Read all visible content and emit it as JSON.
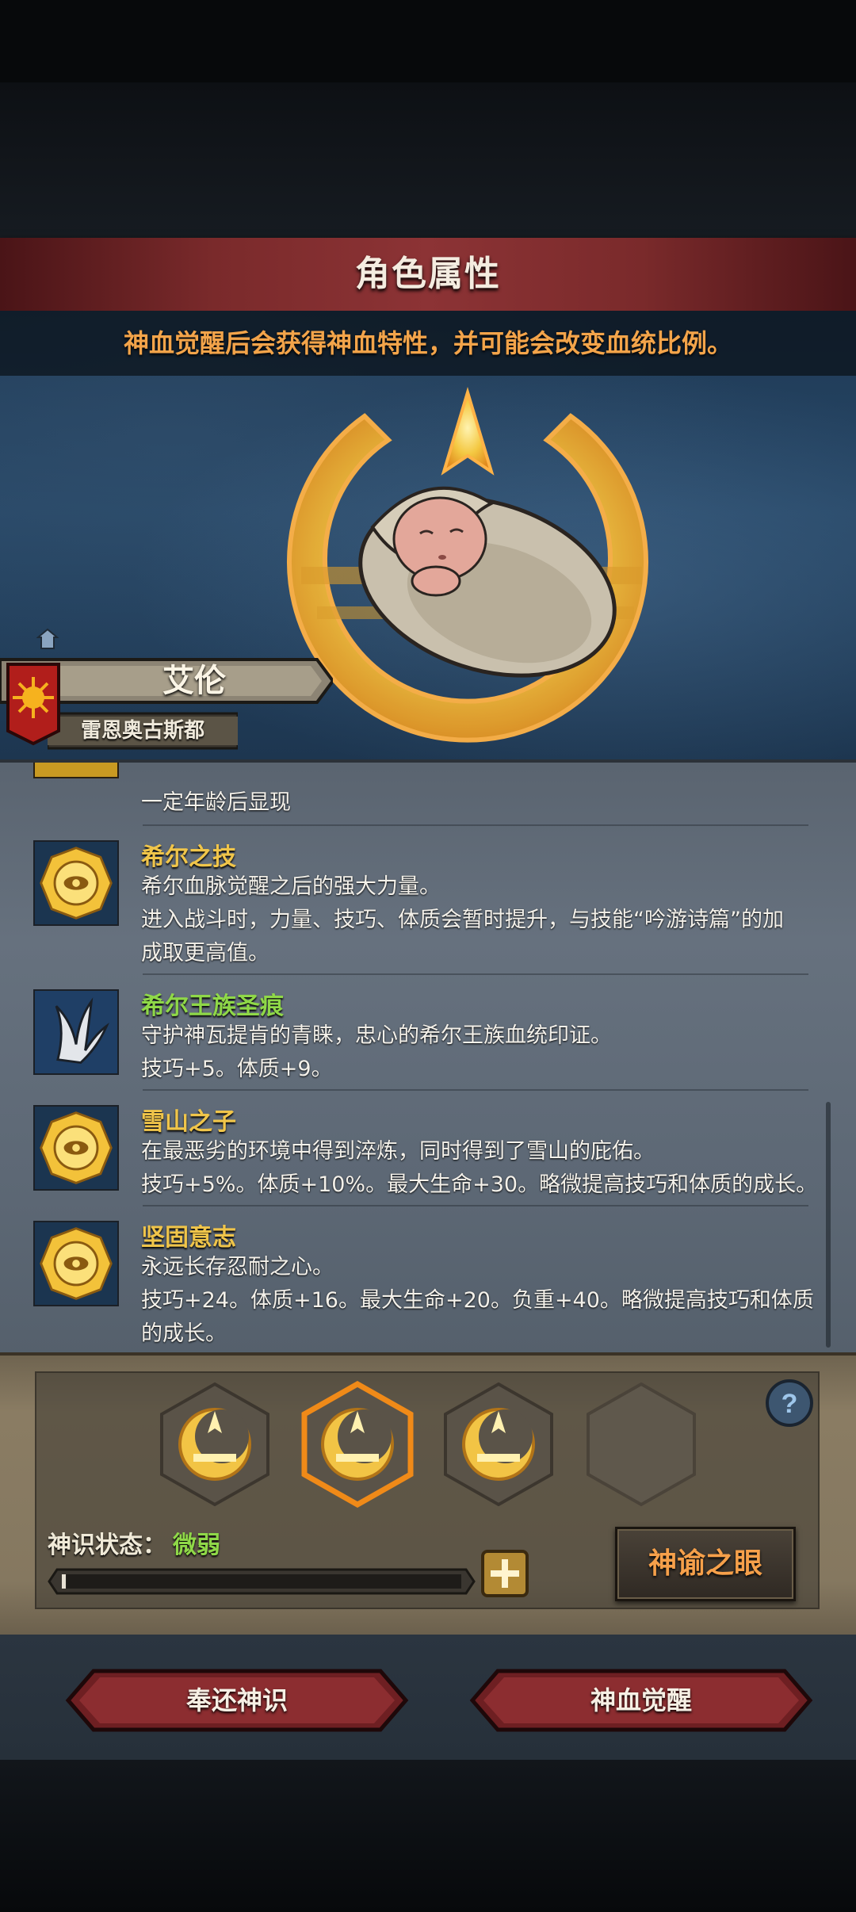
{
  "header": {
    "title": "角色属性"
  },
  "notice": "神血觉醒后会获得神血特性，并可能会改变血统比例。",
  "character": {
    "name": "艾伦",
    "origin": "雷恩奥古斯都"
  },
  "traits": [
    {
      "title": "",
      "desc": [
        "一定年龄后显现"
      ],
      "icon": "lock-icon"
    },
    {
      "title": "希尔之技",
      "desc": [
        "希尔血脉觉醒之后的强大力量。",
        "进入战斗时，力量、技巧、体质会暂时提升，与技能“吟游诗篇”的加",
        "成取更高值。"
      ],
      "icon": "sun-eye-medallion-icon"
    },
    {
      "title": "希尔王族圣痕",
      "desc": [
        "守护神瓦提肯的青睐，忠心的希尔王族血统印证。",
        "技巧+5。体质+9。"
      ],
      "icon": "claw-icon",
      "title_color": "#8fd848"
    },
    {
      "title": "雪山之子",
      "desc": [
        "在最恶劣的环境中得到淬炼，同时得到了雪山的庇佑。",
        "技巧+5%。体质+10%。最大生命+30。略微提高技巧和体质的成长。"
      ],
      "icon": "sun-eye-medallion-icon"
    },
    {
      "title": "坚固意志",
      "desc": [
        "永远长存忍耐之心。",
        "技巧+24。体质+16。最大生命+20。负重+40。略微提高技巧和体质",
        "的成长。"
      ],
      "icon": "sun-eye-medallion-icon"
    }
  ],
  "divine_sense": {
    "label": "神识状态：",
    "value": "微弱",
    "progress": 0.01
  },
  "buttons": {
    "oracle": "神谕之眼",
    "return_sense": "奉还神识",
    "awaken": "神血觉醒",
    "help": "?"
  },
  "colors": {
    "gold": "#f0c54a",
    "green": "#8fd848",
    "orange": "#f3a44a"
  }
}
